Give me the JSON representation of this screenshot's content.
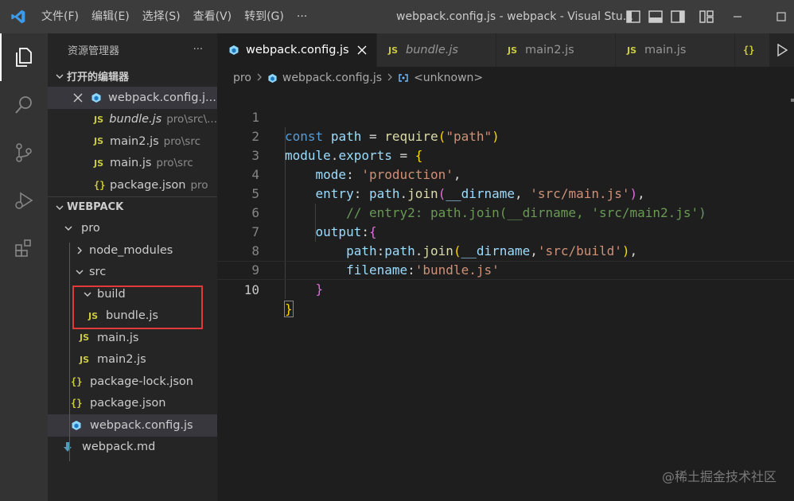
{
  "titlebar": {
    "menu": [
      "文件(F)",
      "编辑(E)",
      "选择(S)",
      "查看(V)",
      "转到(G)",
      "···"
    ],
    "window_title": "webpack.config.js - webpack - Visual Stu..."
  },
  "sidebar": {
    "title": "资源管理器",
    "more": "···",
    "open_editors_label": "打开的编辑器",
    "open_editors": [
      {
        "name": "webpack.config.j...",
        "desc": "",
        "icon": "webpack-icon",
        "italic": false
      },
      {
        "name": "bundle.js",
        "desc": "pro\\src\\...",
        "icon": "JS",
        "italic": true
      },
      {
        "name": "main2.js",
        "desc": "pro\\src",
        "icon": "JS",
        "italic": false
      },
      {
        "name": "main.js",
        "desc": "pro\\src",
        "icon": "JS",
        "italic": false
      },
      {
        "name": "package.json",
        "desc": "pro",
        "icon": "{}",
        "italic": false
      }
    ],
    "workspace_label": "WEBPACK",
    "tree": {
      "pro": "pro",
      "node_modules": "node_modules",
      "src": "src",
      "build": "build",
      "bundle": "bundle.js",
      "main": "main.js",
      "main2": "main2.js",
      "package_lock": "package-lock.json",
      "package": "package.json",
      "webpack_config": "webpack.config.js",
      "webpack_md": "webpack.md"
    },
    "js_badge": "JS",
    "json_badge": "{}"
  },
  "tabs": [
    {
      "label": "webpack.config.js",
      "active": true
    },
    {
      "label": "bundle.js",
      "italic": true
    },
    {
      "label": "main2.js"
    },
    {
      "label": "main.js"
    },
    {
      "label": "{}"
    }
  ],
  "breadcrumb": {
    "folder": "pro",
    "file": "webpack.config.js",
    "symbol": "<unknown>"
  },
  "code": {
    "line_numbers": [
      "1",
      "2",
      "3",
      "4",
      "5",
      "6",
      "7",
      "8",
      "9",
      "10"
    ],
    "current_line": 10,
    "l1": {
      "kw": "const",
      "var": "path",
      "eq": " = ",
      "fn": "require",
      "po": "(",
      "str": "\"path\"",
      "pc": ")"
    },
    "l2": {
      "obj": "module",
      "dot": ".",
      "prop": "exports",
      "eq": " = ",
      "brace": "{"
    },
    "l3": {
      "key": "mode",
      "colon": ": ",
      "str": "'production'",
      "comma": ","
    },
    "l4": {
      "key": "entry",
      "colon": ": ",
      "obj": "path",
      "dot": ".",
      "fn": "join",
      "po": "(",
      "arg": "__dirname",
      "sep": ", ",
      "str": "'src/main.js'",
      "pc": ")",
      "comma": ","
    },
    "l5": {
      "comment": "// entry2: path.join(__dirname, 'src/main2.js')"
    },
    "l6": {
      "key": "output",
      "colon": ":",
      "brace": "{"
    },
    "l7": {
      "key": "path",
      "colon": ":",
      "obj": "path",
      "dot": ".",
      "fn": "join",
      "po": "(",
      "arg": "__dirname",
      "sep": ",",
      "str": "'src/build'",
      "pc": ")",
      "comma": ","
    },
    "l8": {
      "key": "filename",
      "colon": ":",
      "str": "'bundle.js'"
    },
    "l9": {
      "brace": "}"
    },
    "l10": {
      "brace": "}"
    }
  },
  "watermark": "@稀土掘金技术社区",
  "colors": {
    "accent": "#007acc",
    "js_badge": "#cbcb41",
    "webpack_icon": "#8ed6fb",
    "highlight_box": "#e03a3a"
  }
}
